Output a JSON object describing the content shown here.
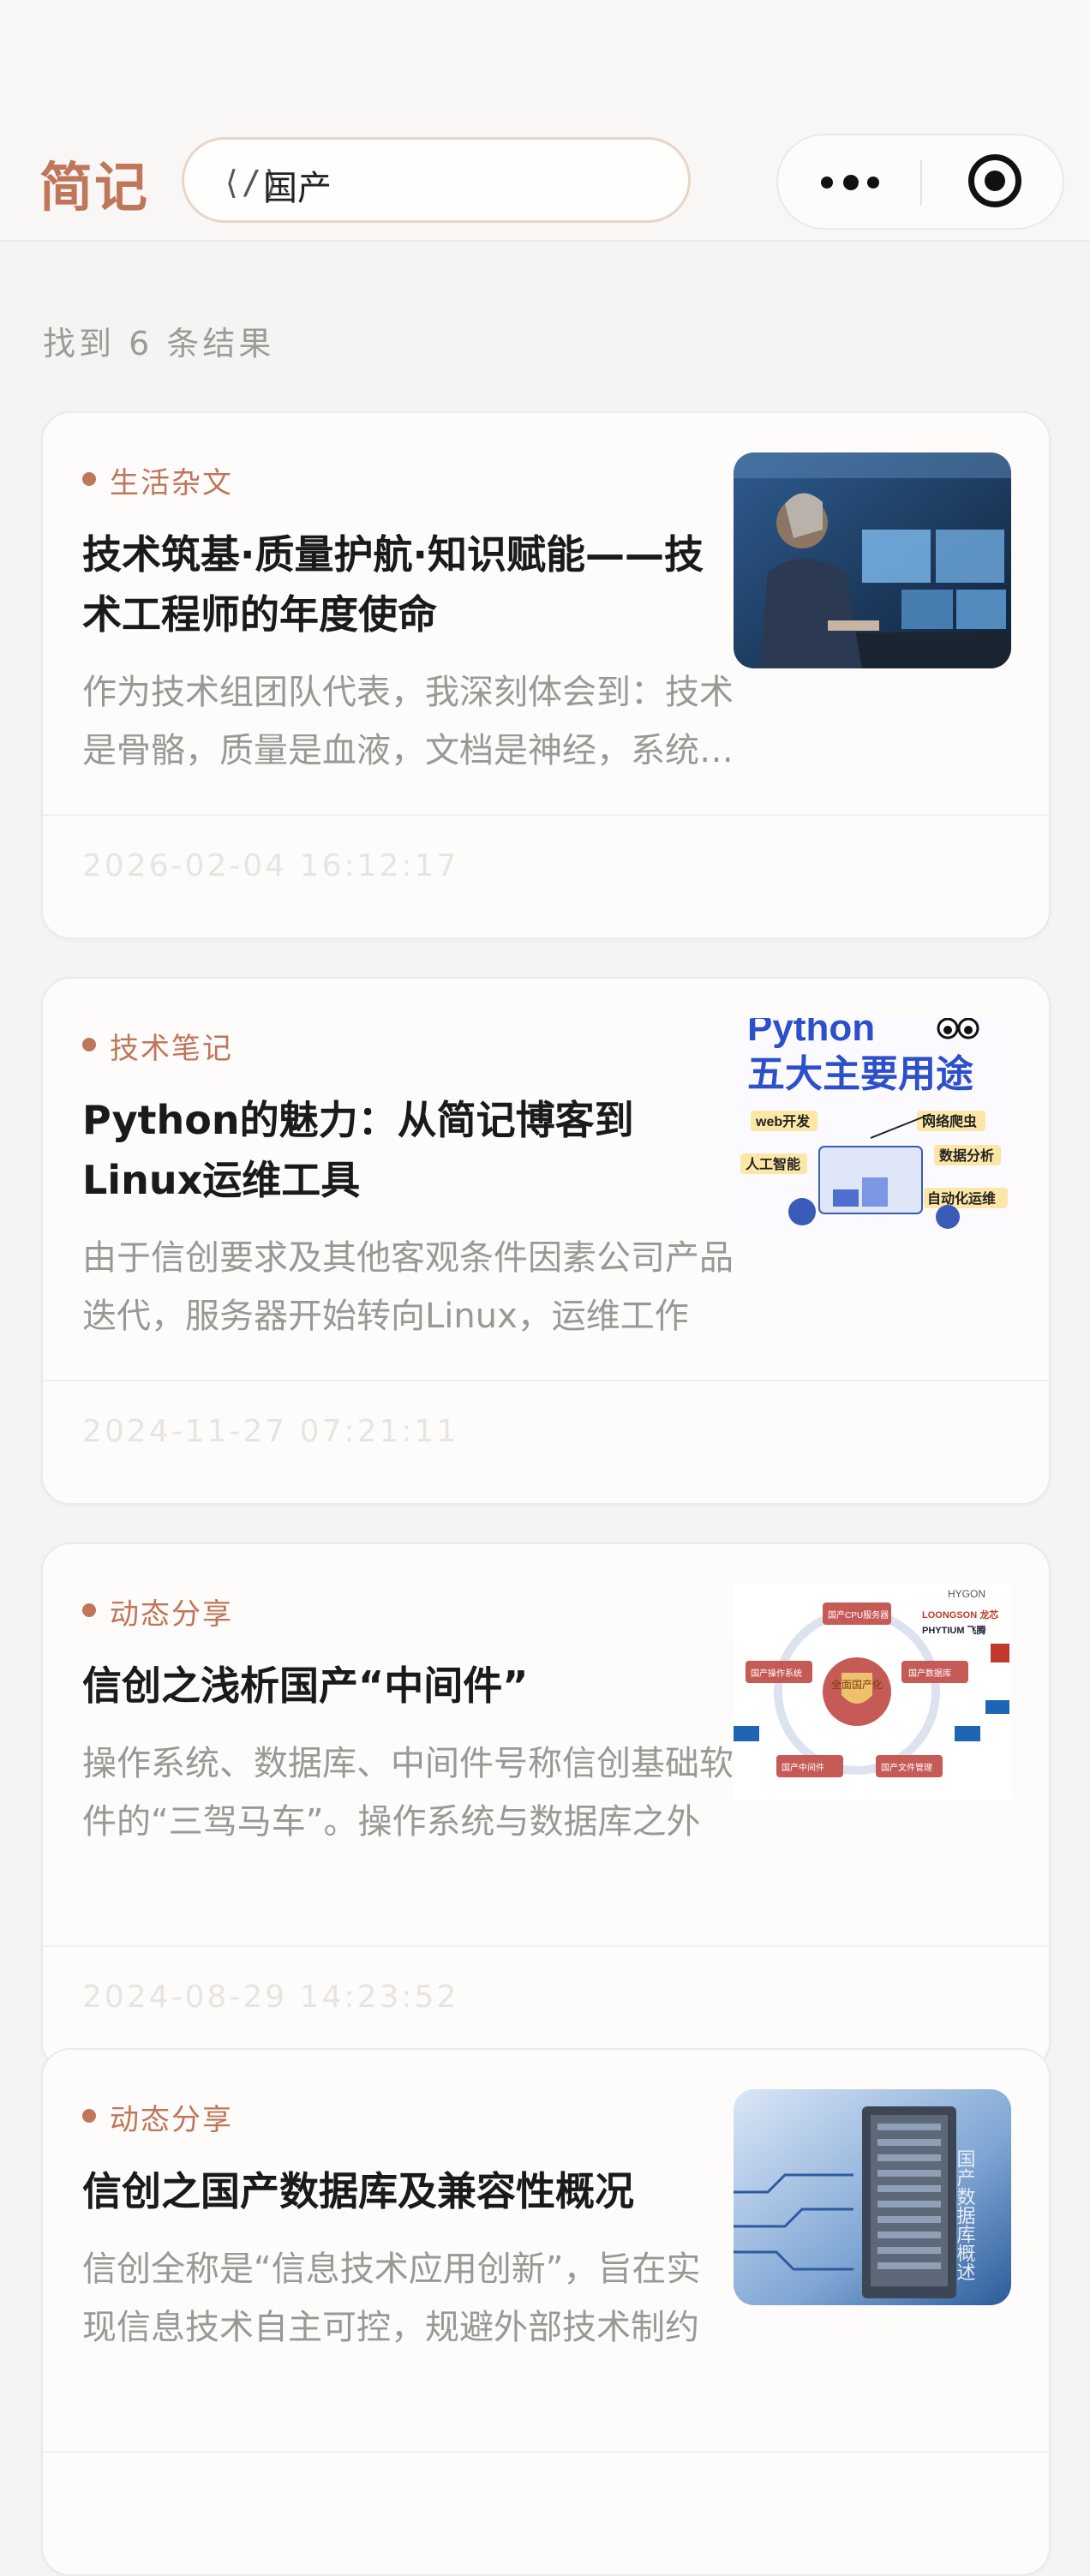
{
  "header": {
    "logo": "简记",
    "search": {
      "icon": "code-slash-icon",
      "icon_text": "⟨/⟩",
      "value": "国产"
    },
    "capsule": {
      "more_icon": "more-dots-icon",
      "close_icon": "target-close-icon"
    }
  },
  "results": {
    "count_text": "找到 6 条结果",
    "items": [
      {
        "category": "生活杂文",
        "title": "技术筑基·质量护航·知识赋能——技术工程师的年度使命",
        "summary": "作为技术组团队代表，我深刻体会到：技术是骨骼，质量是血液，文档是神经，系统运行良好",
        "date": "2026-02-04 16:12:17",
        "thumb": "engineer-at-monitors-image"
      },
      {
        "category": "技术笔记",
        "title": "Python的魅力：从简记博客到Linux运维工具",
        "summary": "由于信创要求及其他客观条件因素公司产品迭代，服务器开始转向Linux，运维工作",
        "date": "2024-11-27 07:21:11",
        "thumb": "python-uses-image",
        "thumb_text": {
          "top": "Python",
          "main": "五大主要用途",
          "tags": [
            "web开发",
            "网络爬虫",
            "人工智能",
            "数据分析",
            "自动化运维"
          ]
        }
      },
      {
        "category": "动态分享",
        "title": "信创之浅析国产“中间件”",
        "summary": "操作系统、数据库、中间件号称信创基础软件的“三驾马车”。操作系统与数据库之外",
        "date": "2024-08-29 14:23:52",
        "thumb": "xinchuang-diagram-image",
        "thumb_text": {
          "center": "全面国产化",
          "nodes": [
            "国产CPU服务器",
            "国产操作系统",
            "国产数据库",
            "国产中间件",
            "国产文件管理"
          ],
          "brands": [
            "HYGON",
            "LOONGSON 龙芯",
            "PHYTIUM 飞腾"
          ]
        }
      },
      {
        "category": "动态分享",
        "title": "信创之国产数据库及兼容性概况",
        "summary": "信创全称是“信息技术应用创新”，旨在实现信息技术自主可控，规避外部技术制约",
        "date": "",
        "thumb": "database-server-image",
        "thumb_text": {
          "vertical": "国产数据库概述"
        }
      }
    ]
  }
}
